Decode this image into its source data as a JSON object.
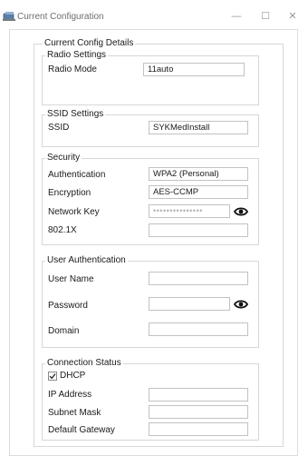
{
  "window": {
    "title": "Current Configuration",
    "minimize_glyph": "—",
    "maximize_glyph": "☐",
    "close_glyph": "✕"
  },
  "current_config": {
    "legend": "Current Config Details",
    "radio_settings": {
      "legend": "Radio Settings",
      "radio_mode_label": "Radio Mode",
      "radio_mode_value": "11auto"
    },
    "ssid_settings": {
      "legend": "SSID Settings",
      "ssid_label": "SSID",
      "ssid_value": "SYKMedInstall"
    },
    "security": {
      "legend": "Security",
      "authentication_label": "Authentication",
      "authentication_value": "WPA2 (Personal)",
      "encryption_label": "Encryption",
      "encryption_value": "AES-CCMP",
      "network_key_label": "Network Key",
      "network_key_value": "•••••••••••••••",
      "dot1x_label": "802.1X",
      "dot1x_value": ""
    },
    "user_authentication": {
      "legend": "User Authentication",
      "user_name_label": "User Name",
      "user_name_value": "",
      "password_label": "Password",
      "password_value": "",
      "domain_label": "Domain",
      "domain_value": ""
    },
    "connection_status": {
      "legend": "Connection Status",
      "dhcp_label": "DHCP",
      "dhcp_checked": true,
      "ip_address_label": "IP Address",
      "ip_address_value": "",
      "subnet_mask_label": "Subnet Mask",
      "subnet_mask_value": "",
      "default_gateway_label": "Default Gateway",
      "default_gateway_value": ""
    }
  },
  "icons": {
    "app": "network-config-icon",
    "show_password": "eye-icon",
    "checkbox_mark": "checkmark-icon"
  }
}
